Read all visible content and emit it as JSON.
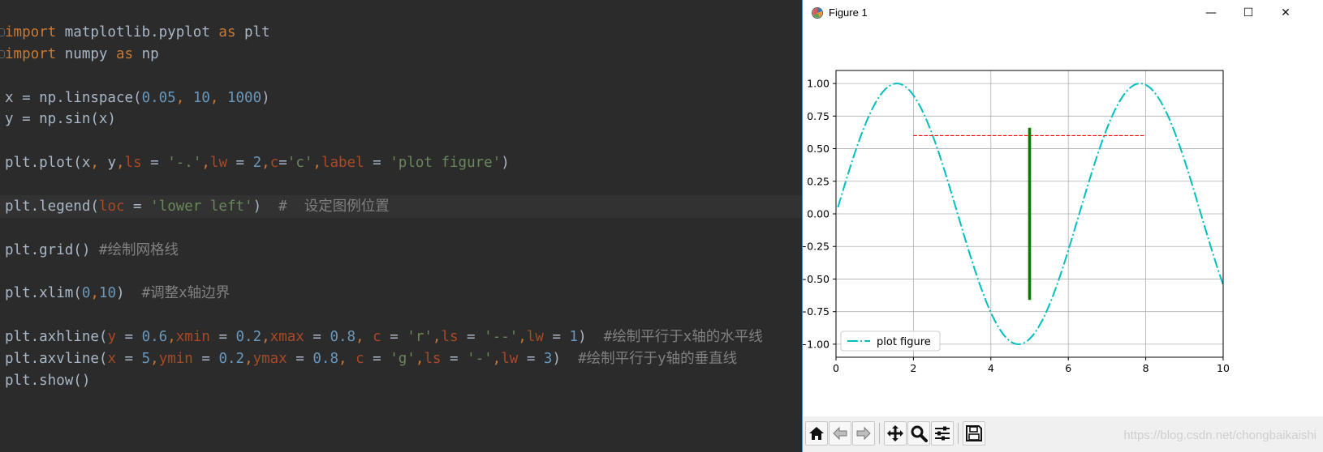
{
  "editor": {
    "lines": [
      [
        {
          "t": "import",
          "c": "kw"
        },
        {
          "t": " matplotlib.pyplot "
        },
        {
          "t": "as",
          "c": "kw"
        },
        {
          "t": " plt"
        }
      ],
      [
        {
          "t": "import",
          "c": "kw"
        },
        {
          "t": " numpy "
        },
        {
          "t": "as",
          "c": "kw"
        },
        {
          "t": " np"
        }
      ],
      [],
      [
        {
          "t": "x = np.linspace("
        },
        {
          "t": "0.05",
          "c": "num"
        },
        {
          "t": ", ",
          "c": "punc"
        },
        {
          "t": "10",
          "c": "num"
        },
        {
          "t": ", ",
          "c": "punc"
        },
        {
          "t": "1000",
          "c": "num"
        },
        {
          "t": ")"
        }
      ],
      [
        {
          "t": "y = np.sin(x)"
        }
      ],
      [],
      [
        {
          "t": "plt.plot(x"
        },
        {
          "t": ", ",
          "c": "punc"
        },
        {
          "t": "y"
        },
        {
          "t": ",",
          "c": "punc"
        },
        {
          "t": "ls",
          "c": "par"
        },
        {
          "t": " = "
        },
        {
          "t": "'-.'",
          "c": "str"
        },
        {
          "t": ",",
          "c": "punc"
        },
        {
          "t": "lw",
          "c": "par"
        },
        {
          "t": " = "
        },
        {
          "t": "2",
          "c": "num"
        },
        {
          "t": ",",
          "c": "punc"
        },
        {
          "t": "c",
          "c": "par"
        },
        {
          "t": "="
        },
        {
          "t": "'c'",
          "c": "str"
        },
        {
          "t": ",",
          "c": "punc"
        },
        {
          "t": "label",
          "c": "par"
        },
        {
          "t": " = "
        },
        {
          "t": "'plot figure'",
          "c": "str"
        },
        {
          "t": ")"
        }
      ],
      [],
      [
        {
          "t": "plt.legend("
        },
        {
          "t": "loc",
          "c": "par"
        },
        {
          "t": " = "
        },
        {
          "t": "'lower left'",
          "c": "str"
        },
        {
          "t": ")  "
        },
        {
          "t": "#  设定图例位置",
          "c": "cmt"
        }
      ],
      [],
      [
        {
          "t": "plt.grid() "
        },
        {
          "t": "#绘制网格线",
          "c": "cmt"
        }
      ],
      [],
      [
        {
          "t": "plt.xlim("
        },
        {
          "t": "0",
          "c": "num"
        },
        {
          "t": ",",
          "c": "punc"
        },
        {
          "t": "10",
          "c": "num"
        },
        {
          "t": ")  "
        },
        {
          "t": "#调整x轴边界",
          "c": "cmt"
        }
      ],
      [],
      [
        {
          "t": "plt.axhline("
        },
        {
          "t": "y",
          "c": "par"
        },
        {
          "t": " = "
        },
        {
          "t": "0.6",
          "c": "num"
        },
        {
          "t": ",",
          "c": "punc"
        },
        {
          "t": "xmin",
          "c": "par"
        },
        {
          "t": " = "
        },
        {
          "t": "0.2",
          "c": "num"
        },
        {
          "t": ",",
          "c": "punc"
        },
        {
          "t": "xmax",
          "c": "par"
        },
        {
          "t": " = "
        },
        {
          "t": "0.8",
          "c": "num"
        },
        {
          "t": ", ",
          "c": "punc"
        },
        {
          "t": "c",
          "c": "par"
        },
        {
          "t": " = "
        },
        {
          "t": "'r'",
          "c": "str"
        },
        {
          "t": ",",
          "c": "punc"
        },
        {
          "t": "ls",
          "c": "par"
        },
        {
          "t": " = "
        },
        {
          "t": "'--'",
          "c": "str"
        },
        {
          "t": ",",
          "c": "punc"
        },
        {
          "t": "lw",
          "c": "par"
        },
        {
          "t": " = "
        },
        {
          "t": "1",
          "c": "num"
        },
        {
          "t": ")  "
        },
        {
          "t": "#绘制平行于x轴的水平线",
          "c": "cmt"
        }
      ],
      [
        {
          "t": "plt.axvline("
        },
        {
          "t": "x",
          "c": "par"
        },
        {
          "t": " = "
        },
        {
          "t": "5",
          "c": "num"
        },
        {
          "t": ",",
          "c": "punc"
        },
        {
          "t": "ymin",
          "c": "par"
        },
        {
          "t": " = "
        },
        {
          "t": "0.2",
          "c": "num"
        },
        {
          "t": ",",
          "c": "punc"
        },
        {
          "t": "ymax",
          "c": "par"
        },
        {
          "t": " = "
        },
        {
          "t": "0.8",
          "c": "num"
        },
        {
          "t": ", ",
          "c": "punc"
        },
        {
          "t": "c",
          "c": "par"
        },
        {
          "t": " = "
        },
        {
          "t": "'g'",
          "c": "str"
        },
        {
          "t": ",",
          "c": "punc"
        },
        {
          "t": "ls",
          "c": "par"
        },
        {
          "t": " = "
        },
        {
          "t": "'-'",
          "c": "str"
        },
        {
          "t": ",",
          "c": "punc"
        },
        {
          "t": "lw",
          "c": "par"
        },
        {
          "t": " = "
        },
        {
          "t": "3",
          "c": "num"
        },
        {
          "t": ")  "
        },
        {
          "t": "#绘制平行于y轴的垂直线",
          "c": "cmt"
        }
      ],
      [
        {
          "t": "plt.show()"
        }
      ]
    ],
    "current_line": 8,
    "fold_marks": [
      0,
      1
    ]
  },
  "figure_window": {
    "title": "Figure 1",
    "controls": {
      "minimize": "—",
      "maximize": "☐",
      "close": "✕"
    },
    "toolbar_icons": [
      "home-icon",
      "back-arrow-icon",
      "forward-arrow-icon",
      "pan-move-icon",
      "zoom-magnifier-icon",
      "configure-subplots-icon",
      "save-floppy-icon"
    ],
    "watermark": "https://blog.csdn.net/chongbaikaishi"
  },
  "chart_data": {
    "type": "line",
    "title": "",
    "xlabel": "",
    "ylabel": "",
    "xlim": [
      0,
      10
    ],
    "ylim": [
      -1.1,
      1.1
    ],
    "xticks": [
      0,
      2,
      4,
      6,
      8,
      10
    ],
    "xtick_labels": [
      "0",
      "2",
      "4",
      "6",
      "8",
      "10"
    ],
    "yticks": [
      1.0,
      0.75,
      0.5,
      0.25,
      0.0,
      -0.25,
      -0.5,
      -0.75,
      -1.0
    ],
    "ytick_labels": [
      "1.00",
      "0.75",
      "0.50",
      "0.25",
      "0.00",
      "−0.25",
      "−0.50",
      "−0.75",
      "−1.00"
    ],
    "grid": true,
    "legend": {
      "placement": "lower-left",
      "entries": [
        "plot figure"
      ]
    },
    "series": [
      {
        "name": "plot figure",
        "function": "sin(x)",
        "x_start": 0.05,
        "x_end": 10,
        "points": 1000,
        "color": "#00bfbf",
        "linestyle": "dashdot"
      }
    ],
    "hlines": [
      {
        "y": 0.6,
        "xmin_frac": 0.2,
        "xmax_frac": 0.8,
        "color": "#ff0000",
        "linestyle": "dashed"
      }
    ],
    "vlines": [
      {
        "x": 5,
        "ymin_frac": 0.2,
        "ymax_frac": 0.8,
        "color": "#008000",
        "linestyle": "solid"
      }
    ]
  }
}
